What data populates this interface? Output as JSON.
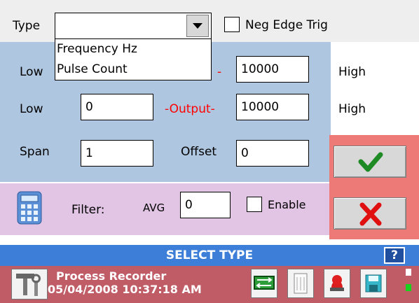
{
  "type_row": {
    "label": "Type",
    "selected": "",
    "neg_edge_label": "Neg Edge Trig"
  },
  "type_options": [
    "Frequency Hz",
    "Pulse Count"
  ],
  "input_row": {
    "low_label": "Low",
    "hidden_label_fragment": "-",
    "high_value": "10000",
    "high_label": "High"
  },
  "output_row": {
    "low_label": "Low",
    "low_value": "0",
    "label": "-Output-",
    "high_value": "10000",
    "high_label": "High"
  },
  "scaling": {
    "span_label": "Span",
    "span_value": "1",
    "offset_label": "Offset",
    "offset_value": "0"
  },
  "filter": {
    "label": "Filter:",
    "avg_label": "AVG",
    "avg_value": "0",
    "enable_label": "Enable"
  },
  "type_bar": {
    "title": "SELECT TYPE",
    "help_label": "?"
  },
  "status": {
    "app_name": "Process Recorder",
    "datetime": "05/04/2008 10:37:18 AM"
  },
  "colors": {
    "blue_panel": "#aec6df",
    "filter_panel": "#e2c4e4",
    "action_panel": "#ee7a77",
    "type_bar": "#3d7fd8",
    "status_bar": "#c05c66",
    "output_label": "#ff0000"
  },
  "icons": [
    "dropdown-arrow-icon",
    "calculator-icon",
    "checkmark-icon",
    "x-icon",
    "settings-tools-icon",
    "network-icon",
    "list-icon",
    "alarm-icon",
    "save-icon",
    "status-indicator-icon"
  ]
}
